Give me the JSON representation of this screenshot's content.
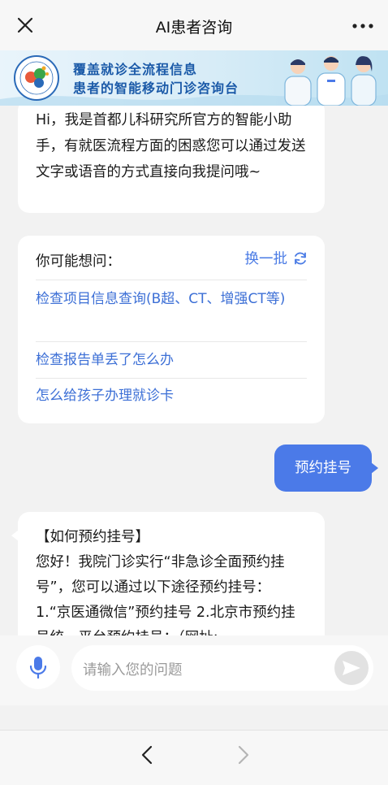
{
  "header": {
    "title": "AI患者咨询",
    "close_icon": "close-icon",
    "more_icon": "more-dots-icon"
  },
  "banner": {
    "line1": "覆盖就诊全流程信息",
    "line2": "患者的智能移动门诊咨询台",
    "logo_text": "CAPITAL INSTITUTE OF PEDIATRICS",
    "logo_year": "1958",
    "colors": {
      "primary_text": "#1b5aa8",
      "background": "#d7ecf7"
    }
  },
  "chat": {
    "greeting": "Hi，我是首都儿科研究所官方的智能小助手，有就医流程方面的困惑您可以通过发送文字或语音的方式直接向我提问哦~",
    "suggestions": {
      "title": "你可能想问：",
      "refresh_label": "换一批",
      "items": [
        "检查项目信息查询(B超、CT、增强CT等)",
        "检查报告单丢了怎么办",
        "怎么给孩子办理就诊卡"
      ]
    },
    "user_message": "预约挂号",
    "answer_title": "【如何预约挂号】",
    "answer_body": "您好！我院门诊实行“非急诊全面预约挂号”，您可以通过以下途径预约挂号：  1.“京医通微信”预约挂号 2.北京市预约挂号统一平台预约挂号：（网址: www.bjguahao.gov.cn）"
  },
  "input": {
    "placeholder": "请输入您的问题",
    "mic_icon": "microphone-icon",
    "send_icon": "send-icon"
  },
  "nav": {
    "back_icon": "chevron-left-icon",
    "forward_icon": "chevron-right-icon"
  },
  "colors": {
    "accent": "#4b7ae8",
    "link": "#3c6fd6"
  }
}
